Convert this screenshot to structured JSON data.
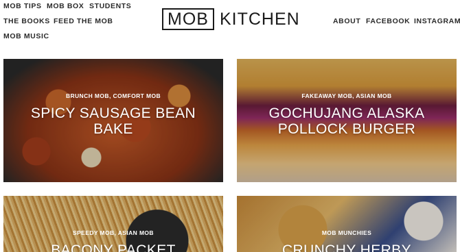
{
  "nav_left": {
    "row1": [
      "MOB TIPS",
      "MOB BOX",
      "STUDENTS"
    ],
    "row2": [
      "THE BOOKS",
      "FEED THE MOB"
    ],
    "row3": [
      "MOB MUSIC"
    ]
  },
  "logo": {
    "boxed": "MOB",
    "text": "KITCHEN"
  },
  "nav_right": [
    "ABOUT",
    "FACEBOOK",
    "INSTAGRAM"
  ],
  "cards": [
    {
      "tags": "BRUNCH MOB, COMFORT MOB",
      "title_line1": "SPICY SAUSAGE BEAN",
      "title_line2": "BAKE"
    },
    {
      "tags": "FAKEAWAY MOB, ASIAN MOB",
      "title_line1": "GOCHUJANG ALASKA",
      "title_line2": "POLLOCK BURGER"
    },
    {
      "tags": "SPEEDY MOB, ASIAN MOB",
      "title_line1": "BACONY PACKET"
    },
    {
      "tags": "MOB MUNCHIES",
      "title_line1": "CRUNCHY HERBY"
    }
  ]
}
